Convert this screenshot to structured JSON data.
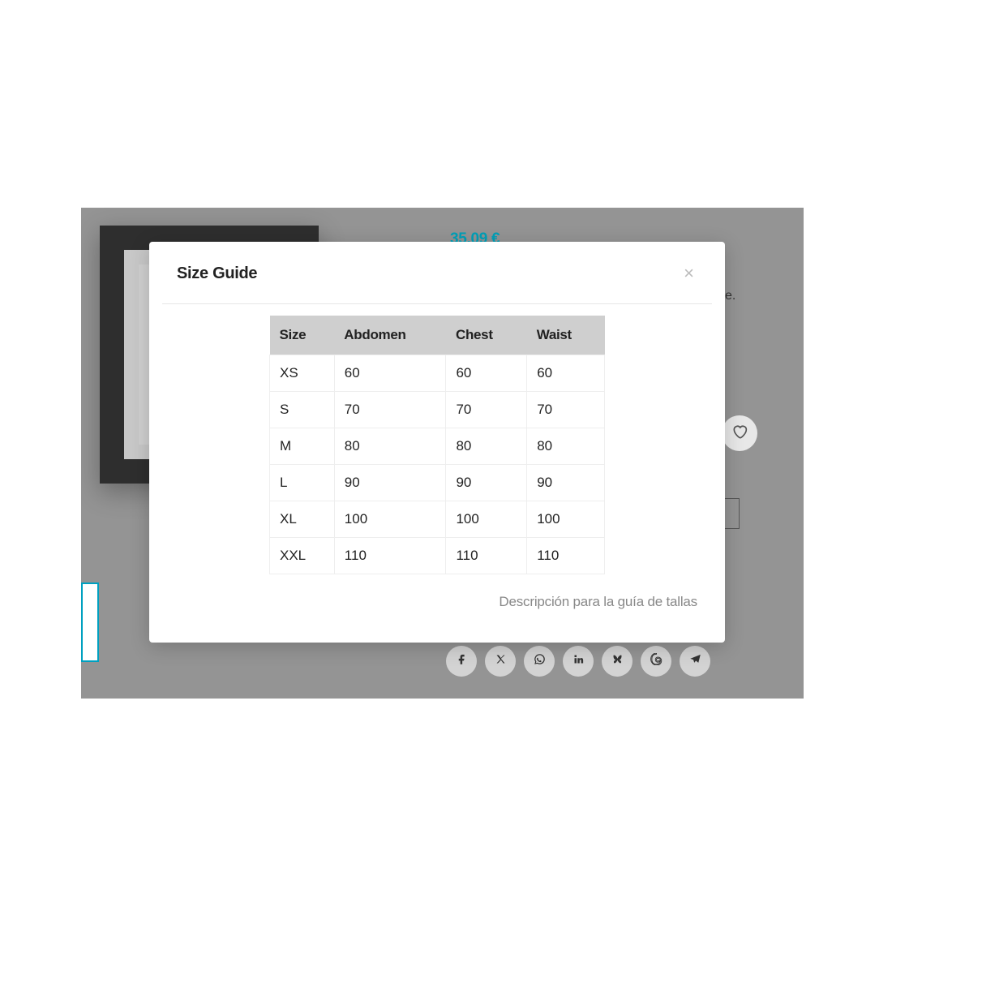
{
  "modal": {
    "title": "Size Guide",
    "footer_text": "Descripción para la guía de tallas",
    "headers": [
      "Size",
      "Abdomen",
      "Chest",
      "Waist"
    ],
    "rows": [
      [
        "XS",
        "60",
        "60",
        "60"
      ],
      [
        "S",
        "70",
        "70",
        "70"
      ],
      [
        "M",
        "80",
        "80",
        "80"
      ],
      [
        "L",
        "90",
        "90",
        "90"
      ],
      [
        "XL",
        "100",
        "100",
        "100"
      ],
      [
        "XXL",
        "110",
        "110",
        "110"
      ]
    ]
  },
  "product": {
    "price": "35,09 €",
    "text_fragment": "e."
  },
  "socials": [
    "facebook",
    "x-twitter",
    "whatsapp",
    "linkedin",
    "bluesky",
    "threads",
    "telegram"
  ]
}
